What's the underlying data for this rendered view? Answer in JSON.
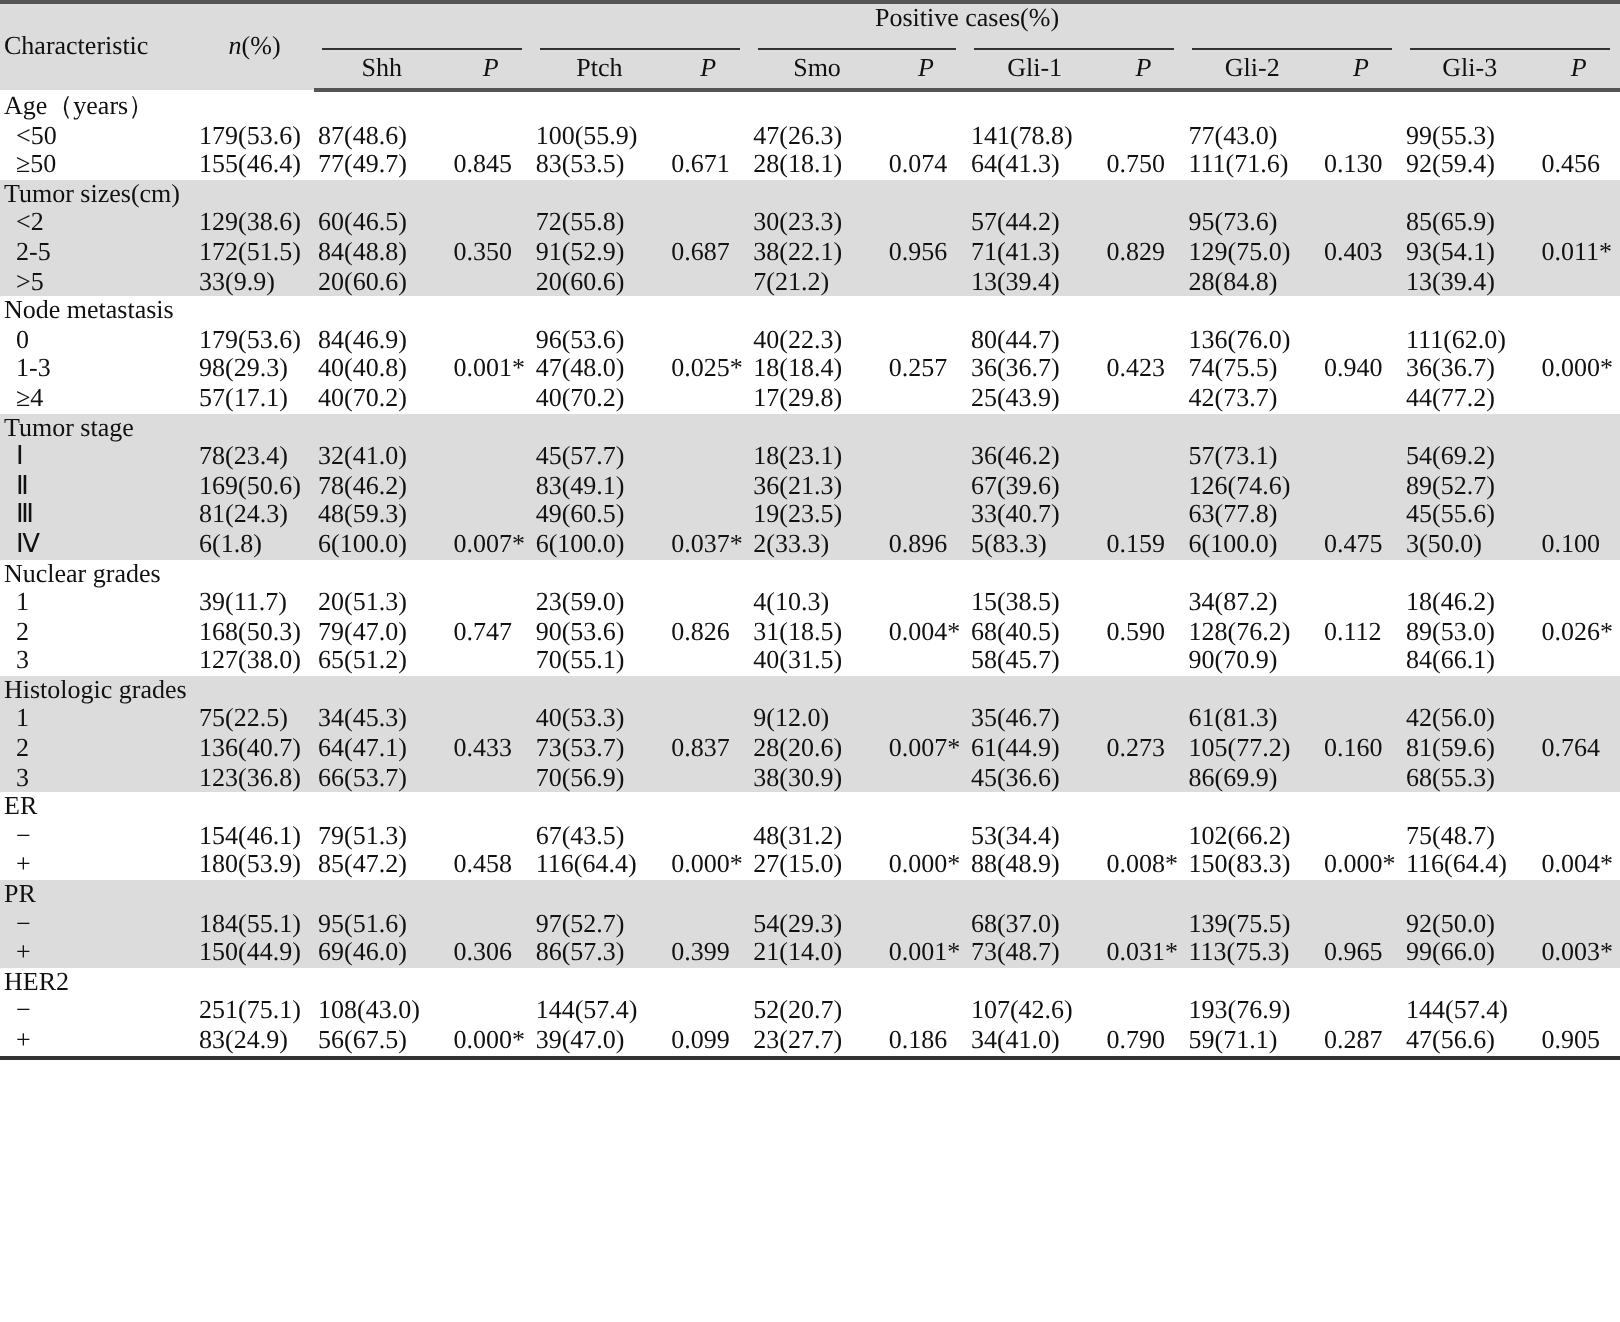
{
  "table": {
    "header": {
      "characteristic": "Characteristic",
      "n": "*n*(%)",
      "group": "Positive cases(%)",
      "columns": [
        "Shh",
        "P",
        "Ptch",
        "P",
        "Smo",
        "P",
        "Gli-1",
        "P",
        "Gli-2",
        "P",
        "Gli-3",
        "P"
      ]
    },
    "groups": [
      {
        "label": "Age（years）",
        "rows": [
          {
            "label": "<50",
            "cells": [
              "179(53.6)",
              "87(48.6)",
              null,
              "100(55.9)",
              null,
              "47(26.3)",
              null,
              "141(78.8)",
              null,
              "77(43.0)",
              null,
              "99(55.3)",
              null
            ]
          },
          {
            "label": "≥50",
            "cells": [
              "155(46.4)",
              "77(49.7)",
              "0.845",
              "83(53.5)",
              "0.671",
              "28(18.1)",
              "0.074",
              "64(41.3)",
              "0.750",
              "111(71.6)",
              "0.130",
              "92(59.4)",
              "0.456"
            ]
          }
        ]
      },
      {
        "label": "Tumor sizes(cm)",
        "rows": [
          {
            "label": "<2",
            "cells": [
              "129(38.6)",
              "60(46.5)",
              null,
              "72(55.8)",
              null,
              "30(23.3)",
              null,
              "57(44.2)",
              null,
              "95(73.6)",
              null,
              "85(65.9)",
              null
            ]
          },
          {
            "label": "2-5",
            "cells": [
              "172(51.5)",
              "84(48.8)",
              "0.350",
              "91(52.9)",
              "0.687",
              "38(22.1)",
              "0.956",
              "71(41.3)",
              "0.829",
              "129(75.0)",
              "0.403",
              "93(54.1)",
              "0.011*"
            ]
          },
          {
            "label": ">5",
            "cells": [
              "33(9.9)",
              "20(60.6)",
              null,
              "20(60.6)",
              null,
              "7(21.2)",
              null,
              "13(39.4)",
              null,
              "28(84.8)",
              null,
              "13(39.4)",
              null
            ]
          }
        ]
      },
      {
        "label": "Node metastasis",
        "rows": [
          {
            "label": "0",
            "cells": [
              "179(53.6)",
              "84(46.9)",
              null,
              "96(53.6)",
              null,
              "40(22.3)",
              null,
              "80(44.7)",
              null,
              "136(76.0)",
              null,
              "111(62.0)",
              null
            ]
          },
          {
            "label": "1-3",
            "cells": [
              "98(29.3)",
              "40(40.8)",
              "0.001*",
              "47(48.0)",
              "0.025*",
              "18(18.4)",
              "0.257",
              "36(36.7)",
              "0.423",
              "74(75.5)",
              "0.940",
              "36(36.7)",
              "0.000*"
            ]
          },
          {
            "label": "≥4",
            "cells": [
              "57(17.1)",
              "40(70.2)",
              null,
              "40(70.2)",
              null,
              "17(29.8)",
              null,
              "25(43.9)",
              null,
              "42(73.7)",
              null,
              "44(77.2)",
              null
            ]
          }
        ]
      },
      {
        "label": "Tumor  stage",
        "rows": [
          {
            "label": "Ⅰ",
            "cells": [
              "78(23.4)",
              "32(41.0)",
              null,
              "45(57.7)",
              null,
              "18(23.1)",
              null,
              "36(46.2)",
              null,
              "57(73.1)",
              null,
              "54(69.2)",
              null
            ]
          },
          {
            "label": "Ⅱ",
            "cells": [
              "169(50.6)",
              "78(46.2)",
              null,
              "83(49.1)",
              null,
              "36(21.3)",
              null,
              "67(39.6)",
              null,
              "126(74.6)",
              null,
              "89(52.7)",
              null
            ]
          },
          {
            "label": "Ⅲ",
            "cells": [
              "81(24.3)",
              "48(59.3)",
              null,
              "49(60.5)",
              null,
              "19(23.5)",
              null,
              "33(40.7)",
              null,
              "63(77.8)",
              null,
              "45(55.6)",
              null
            ]
          },
          {
            "label": "Ⅳ",
            "cells": [
              "6(1.8)",
              "6(100.0)",
              "0.007*",
              "6(100.0)",
              "0.037*",
              "2(33.3)",
              "0.896",
              "5(83.3)",
              "0.159",
              "6(100.0)",
              "0.475",
              "3(50.0)",
              "0.100"
            ]
          }
        ]
      },
      {
        "label": "Nuclear grades",
        "rows": [
          {
            "label": "1",
            "cells": [
              "39(11.7)",
              "20(51.3)",
              null,
              "23(59.0)",
              null,
              "4(10.3)",
              null,
              "15(38.5)",
              null,
              "34(87.2)",
              null,
              "18(46.2)",
              null
            ]
          },
          {
            "label": "2",
            "cells": [
              "168(50.3)",
              "79(47.0)",
              "0.747",
              "90(53.6)",
              "0.826",
              "31(18.5)",
              "0.004*",
              "68(40.5)",
              "0.590",
              "128(76.2)",
              "0.112",
              "89(53.0)",
              "0.026*"
            ]
          },
          {
            "label": "3",
            "cells": [
              "127(38.0)",
              "65(51.2)",
              null,
              "70(55.1)",
              null,
              "40(31.5)",
              null,
              "58(45.7)",
              null,
              "90(70.9)",
              null,
              "84(66.1)",
              null
            ]
          }
        ]
      },
      {
        "label": "Histologic grades",
        "rows": [
          {
            "label": "1",
            "cells": [
              "75(22.5)",
              "34(45.3)",
              null,
              "40(53.3)",
              null,
              "9(12.0)",
              null,
              "35(46.7)",
              null,
              "61(81.3)",
              null,
              "42(56.0)",
              null
            ]
          },
          {
            "label": "2",
            "cells": [
              "136(40.7)",
              "64(47.1)",
              "0.433",
              "73(53.7)",
              "0.837",
              "28(20.6)",
              "0.007*",
              "61(44.9)",
              "0.273",
              "105(77.2)",
              "0.160",
              "81(59.6)",
              "0.764"
            ]
          },
          {
            "label": "3",
            "cells": [
              "123(36.8)",
              "66(53.7)",
              null,
              "70(56.9)",
              null,
              "38(30.9)",
              null,
              "45(36.6)",
              null,
              "86(69.9)",
              null,
              "68(55.3)",
              null
            ]
          }
        ]
      },
      {
        "label": "ER",
        "rows": [
          {
            "label": "−",
            "cells": [
              "154(46.1)",
              "79(51.3)",
              null,
              "67(43.5)",
              null,
              "48(31.2)",
              null,
              "53(34.4)",
              null,
              "102(66.2)",
              null,
              "75(48.7)",
              null
            ]
          },
          {
            "label": "+",
            "cells": [
              "180(53.9)",
              "85(47.2)",
              "0.458",
              "116(64.4)",
              "0.000*",
              "27(15.0)",
              "0.000*",
              "88(48.9)",
              "0.008*",
              "150(83.3)",
              "0.000*",
              "116(64.4)",
              "0.004*"
            ]
          }
        ]
      },
      {
        "label": "PR",
        "rows": [
          {
            "label": "−",
            "cells": [
              "184(55.1)",
              "95(51.6)",
              null,
              "97(52.7)",
              null,
              "54(29.3)",
              null,
              "68(37.0)",
              null,
              "139(75.5)",
              null,
              "92(50.0)",
              null
            ]
          },
          {
            "label": "+",
            "cells": [
              "150(44.9)",
              "69(46.0)",
              "0.306",
              "86(57.3)",
              "0.399",
              "21(14.0)",
              "0.001*",
              "73(48.7)",
              "0.031*",
              "113(75.3)",
              "0.965",
              "99(66.0)",
              "0.003*"
            ]
          }
        ]
      },
      {
        "label": "HER2",
        "rows": [
          {
            "label": "−",
            "cells": [
              "251(75.1)",
              "108(43.0)",
              null,
              "144(57.4)",
              null,
              "52(20.7)",
              null,
              "107(42.6)",
              null,
              "193(76.9)",
              null,
              "144(57.4)",
              null
            ]
          },
          {
            "label": "+",
            "cells": [
              "83(24.9)",
              "56(67.5)",
              "0.000*",
              "39(47.0)",
              "0.099",
              "23(27.7)",
              "0.186",
              "34(41.0)",
              "0.790",
              "59(71.1)",
              "0.287",
              "47(56.6)",
              "0.905"
            ]
          }
        ]
      }
    ]
  }
}
